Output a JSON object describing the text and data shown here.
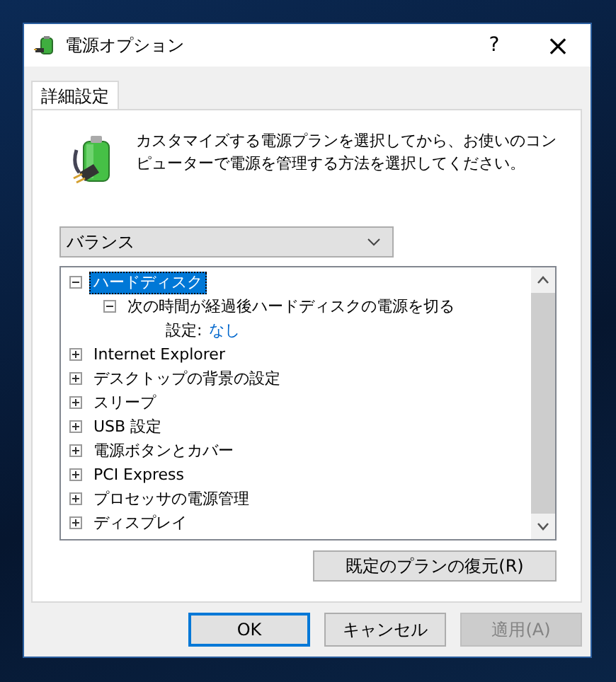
{
  "window": {
    "title": "電源オプション",
    "help": "?",
    "close": "×"
  },
  "tabs": [
    {
      "label": "詳細設定",
      "selected": true
    }
  ],
  "description": "カスタマイズする電源プランを選択してから、お使いのコンピューターで電源を管理する方法を選択してください。",
  "plan_dropdown": {
    "value": "バランス"
  },
  "tree": [
    {
      "label": "ハードディスク",
      "expanded": true,
      "selected": true,
      "children": [
        {
          "label": "次の時間が経過後ハードディスクの電源を切る",
          "expanded": true,
          "selected": false,
          "children": [
            {
              "kind": "setting",
              "label": "設定:",
              "value": "なし"
            }
          ]
        }
      ]
    },
    {
      "label": "Internet Explorer",
      "expanded": false,
      "selected": false
    },
    {
      "label": "デスクトップの背景の設定",
      "expanded": false,
      "selected": false
    },
    {
      "label": "スリープ",
      "expanded": false,
      "selected": false
    },
    {
      "label": "USB 設定",
      "expanded": false,
      "selected": false
    },
    {
      "label": "電源ボタンとカバー",
      "expanded": false,
      "selected": false
    },
    {
      "label": "PCI Express",
      "expanded": false,
      "selected": false
    },
    {
      "label": "プロセッサの電源管理",
      "expanded": false,
      "selected": false
    },
    {
      "label": "ディスプレイ",
      "expanded": false,
      "selected": false
    }
  ],
  "restore_button": "既定のプランの復元(R)",
  "buttons": [
    {
      "label": "OK",
      "default": true,
      "disabled": false
    },
    {
      "label": "キャンセル",
      "default": false,
      "disabled": false
    },
    {
      "label": "適用(A)",
      "default": false,
      "disabled": true
    }
  ]
}
